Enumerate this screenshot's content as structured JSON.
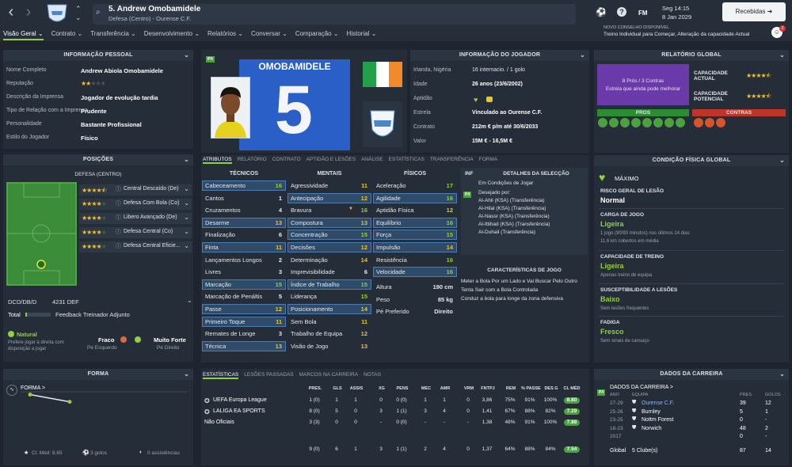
{
  "header": {
    "player_title": "5. Andrew Omobamidele",
    "subtitle": "Defesa (Centro) - Ourense C.F.",
    "date": "Seg 14:15",
    "date2": "8 Jan 2029",
    "inbox": "Recebidas",
    "fm": "FM",
    "notif_count": "2",
    "advice_title": "NOVO CONSELHO DISPONÍVEL",
    "advice_text": "Treino Individual para Começar, Alteração da capacidade Actual"
  },
  "tabs": [
    "Visão Geral ⌄",
    "Contrato ⌄",
    "Transferência ⌄",
    "Desenvolvimento ⌄",
    "Relatórios ⌄",
    "Conversar ⌄",
    "Comparação ⌄",
    "Historial ⌄"
  ],
  "personal": {
    "title": "INFORMAÇÃO PESSOAL",
    "rows": [
      [
        "Nome Completo",
        "Andrew Abiola Omobamidele"
      ],
      [
        "Reputação",
        ""
      ],
      [
        "Descrição da Imprensa",
        "Jogador de evolução tardia"
      ],
      [
        "Tipo de Relação com a Imprensa",
        "Prudente"
      ],
      [
        "Personalidade",
        "Bastante Profissional"
      ],
      [
        "Estilo do Jogador",
        "Físico"
      ]
    ],
    "reputation_stars": 2
  },
  "positions": {
    "title": "POSIÇÕES",
    "subtitle": "DEFESA (CENTRO)",
    "roles": [
      {
        "stars": 4.5,
        "name": "Central Descaído (De)"
      },
      {
        "stars": 4,
        "name": "Defesa Com Bola (Co)"
      },
      {
        "stars": 4,
        "name": "Libero Avançado (De)"
      },
      {
        "stars": 4,
        "name": "Defesa Central (Co)"
      },
      {
        "stars": 4,
        "name": "Defesa Central Eficie..."
      }
    ],
    "formation_line": "DCD/DB/D",
    "formation": "4231 DEF",
    "total": "Total",
    "feedback": "Feedback Treinador Adjunto",
    "foot_natural": "Natural",
    "foot_natural_desc": "Prefere jogar à direita com disposição a jogar",
    "weak_label": "Fraco",
    "weak_foot": "Pé Esquerdo",
    "strong_label": "Muito Forte",
    "strong_foot": "Pé Direito"
  },
  "card": {
    "surname": "OMOBAMIDELE",
    "number": "5",
    "badge": "P/I"
  },
  "playerinfo": {
    "title": "INFORMAÇÃO DO JOGADOR",
    "rows": [
      [
        "Irlanda, Nigéria",
        "16 internacio. / 1 golo"
      ],
      [
        "Idade",
        "26 anos (23/6/2002)"
      ],
      [
        "Aptidão",
        ""
      ],
      [
        "Estrela",
        "Vinculado ao Ourense C.F."
      ],
      [
        "Contrato",
        "212m € p/m até 30/6/2033"
      ],
      [
        "Valor",
        "15M € - 16,5M €"
      ]
    ]
  },
  "report": {
    "title": "RELATÓRIO GLOBAL",
    "pros_count": "8 Prós / 3 Contras",
    "desc": "Estrela que ainda pode melhorar",
    "cap_actual": "CAPACIDADE ACTUAL",
    "cap_potential": "CAPACIDADE POTENCIAL",
    "ca_stars": 4.5,
    "pa_stars": 4.5,
    "pros": "PROS",
    "contras": "CONTRAS"
  },
  "attr_tabs": [
    "ATRIBUTOS",
    "RELATÓRIO",
    "CONTRATO",
    "APTIDÃO E LESÕES",
    "ANÁLISE",
    "ESTATÍSTICAS",
    "TRANSFERÊNCIA",
    "FORMA"
  ],
  "technical": {
    "title": "TÉCNICOS",
    "items": [
      [
        "Cabeceamento",
        "16"
      ],
      [
        "Cantos",
        "1"
      ],
      [
        "Cruzamentos",
        "4"
      ],
      [
        "Desarme",
        "13"
      ],
      [
        "Finalização",
        "6"
      ],
      [
        "Finta",
        "11"
      ],
      [
        "Lançamentos Longos",
        "2"
      ],
      [
        "Livres",
        "3"
      ],
      [
        "Marcação",
        "15"
      ],
      [
        "Marcação de Penáltis",
        "5"
      ],
      [
        "Passe",
        "12"
      ],
      [
        "Primeiro Toque",
        "11"
      ],
      [
        "Remates de Longe",
        "3"
      ],
      [
        "Técnica",
        "13"
      ]
    ]
  },
  "mental": {
    "title": "MENTAIS",
    "items": [
      [
        "Agressividade",
        "11"
      ],
      [
        "Antecipação",
        "12"
      ],
      [
        "Bravura",
        "16"
      ],
      [
        "Compostura",
        "13"
      ],
      [
        "Concentração",
        "15"
      ],
      [
        "Decisões",
        "12"
      ],
      [
        "Determinação",
        "14"
      ],
      [
        "Imprevisibilidade",
        "6"
      ],
      [
        "Índice de Trabalho",
        "15"
      ],
      [
        "Liderança",
        "15"
      ],
      [
        "Posicionamento",
        "14"
      ],
      [
        "Sem Bola",
        "11"
      ],
      [
        "Trabalho de Equipa",
        "12"
      ],
      [
        "Visão de Jogo",
        "13"
      ]
    ]
  },
  "physical": {
    "title": "FÍSICOS",
    "items": [
      [
        "Aceleração",
        "17"
      ],
      [
        "Agilidade",
        "16"
      ],
      [
        "Aptidão Física",
        "12"
      ],
      [
        "Equilíbrio",
        "16"
      ],
      [
        "Força",
        "15"
      ],
      [
        "Impulsão",
        "14"
      ],
      [
        "Resistência",
        "16"
      ],
      [
        "Velocidade",
        "16"
      ]
    ],
    "extra": [
      [
        "Altura",
        "190 cm"
      ],
      [
        "Peso",
        "85 kg"
      ],
      [
        "Pé Preferido",
        "Direito"
      ]
    ]
  },
  "selection": {
    "inf": "INF",
    "title": "DETALHES DA SELECÇÃO",
    "status": "Em Condições de Jogar",
    "wanted_label": "Desejado por:",
    "wanted": [
      "Al-Ahli (KSA) (Transferência)",
      "Al-Hilal (KSA) (Transferência)",
      "Al-Nassr (KSA) (Transferência)",
      "Al-Ittihad (KSA) (Transferência)",
      "Al-Duhail (Transferência)"
    ],
    "badge": "P/I"
  },
  "traits": {
    "title": "CARACTERÍSTICAS DE JOGO",
    "items": [
      "Meter a Bola Por um Lado e Vai Buscar Pelo Outro",
      "Tenta Sair com a Bola Controlada",
      "Conduz a bola para longe da zona defensiva"
    ]
  },
  "condition": {
    "title": "CONDIÇÃO FÍSICA GLOBAL",
    "max": "MÁXIMO",
    "injury_label": "RISCO GERAL DE LESÃO",
    "injury": "Normal",
    "load_label": "CARGA DE JOGO",
    "load": "Ligeira",
    "load_desc": "1 jogo (90/90 minutos) nos últimos 14 dias",
    "load_desc2": "11,6 km cobertos em média",
    "training_label": "CAPACIDADE DE TREINO",
    "training": "Ligeira",
    "training_desc": "Apenas treino de equipa",
    "susc_label": "SUSCEPTIBILIDADE A LESÕES",
    "susc": "Baixo",
    "susc_desc": "Sem lesões frequentes",
    "fatigue_label": "FADIGA",
    "fatigue": "Fresco",
    "fatigue_desc": "Sem sinais de cansaço"
  },
  "form": {
    "title": "FORMA",
    "label": "FORMA >",
    "avg": "Cl. Méd: 8.65",
    "goals": "3 golos",
    "assists": "0 assistências",
    "points": [
      9.5,
      8.2
    ]
  },
  "stats": {
    "tabs": [
      "ESTATÍSTICAS",
      "LESÕES PASSADAS",
      "MARCOS NA CARREIRA",
      "NOTAS"
    ],
    "headers": [
      "PRES.",
      "GLS",
      "ASSIS",
      "XG",
      "PENS",
      "MEC",
      "AMR",
      "VRM",
      "FNTPJ",
      "REM",
      "% PASSE",
      "DES G",
      "CL MÉD"
    ],
    "rows": [
      {
        "name": "UEFA Europa League",
        "cells": [
          "1 (0)",
          "1",
          "1",
          "0",
          "0 (0)",
          "1",
          "1",
          "0",
          "3,86",
          "75%",
          "91%",
          "100%",
          "8.80"
        ]
      },
      {
        "name": "LALIGA EA SPORTS",
        "cells": [
          "8 (0)",
          "5",
          "0",
          "3",
          "1 (1)",
          "3",
          "4",
          "0",
          "1,41",
          "67%",
          "88%",
          "82%",
          "7.29"
        ]
      },
      {
        "name": "Não Oficiais",
        "cells": [
          "3 (3)",
          "0",
          "0",
          "-",
          "0 (0)",
          "-",
          "-",
          "-",
          "1,38",
          "48%",
          "91%",
          "100%",
          "7.88"
        ]
      }
    ],
    "total": [
      "9 (0)",
      "6",
      "1",
      "3",
      "1 (1)",
      "2",
      "4",
      "0",
      "1,37",
      "64%",
      "88%",
      "84%",
      "7.54"
    ]
  },
  "career": {
    "title": "DADOS DA CARREIRA",
    "label": "DADOS DA CARREIRA >",
    "headers": [
      "ANO",
      "EQUIPA",
      "PRES.",
      "GOLOS"
    ],
    "rows": [
      [
        "27-29",
        "Ourense C.F.",
        "39",
        "12"
      ],
      [
        "25-26",
        "Burnley",
        "5",
        "1"
      ],
      [
        "23-25",
        "Nottm Forest",
        "0",
        "-"
      ],
      [
        "18-23",
        "Norwich",
        "48",
        "2"
      ],
      [
        "2017",
        "",
        "0",
        "-"
      ]
    ],
    "total_label": "Global",
    "total_clubs": "5 Clube(s)",
    "total_apps": "87",
    "total_goals": "14",
    "badge": "P/I"
  },
  "colors": {
    "accent": "#8fd23b",
    "bg": "#1e2530",
    "panel": "#252d39",
    "blue": "#2a5fc7"
  }
}
